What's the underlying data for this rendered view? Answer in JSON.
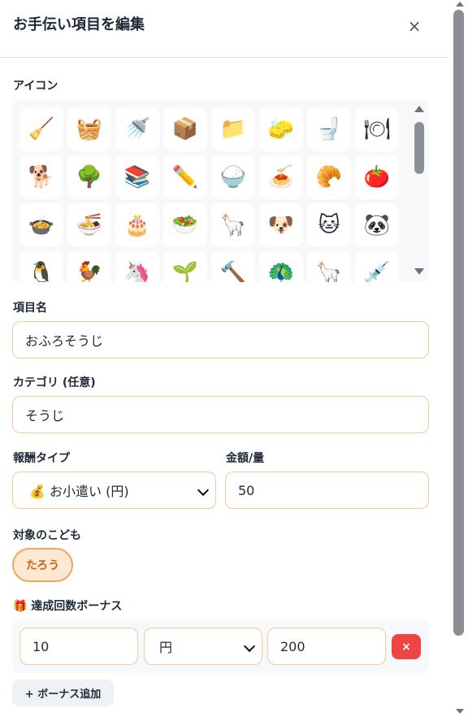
{
  "header": {
    "title": "お手伝い項目を編集",
    "close_label": "×"
  },
  "icon_section": {
    "label": "アイコン",
    "icons": [
      {
        "name": "broom-icon",
        "glyph": "🧹"
      },
      {
        "name": "basket-icon",
        "glyph": "🧺"
      },
      {
        "name": "shower-icon",
        "glyph": "🚿"
      },
      {
        "name": "package-icon",
        "glyph": "📦"
      },
      {
        "name": "folder-icon",
        "glyph": "📁"
      },
      {
        "name": "sponge-icon",
        "glyph": "🧽"
      },
      {
        "name": "toilet-icon",
        "glyph": "🚽"
      },
      {
        "name": "plate-cutlery-icon",
        "glyph": "🍽"
      },
      {
        "name": "dog-icon",
        "glyph": "🐕"
      },
      {
        "name": "tree-icon",
        "glyph": "🌳"
      },
      {
        "name": "books-icon",
        "glyph": "📚"
      },
      {
        "name": "pencil-icon",
        "glyph": "✏️"
      },
      {
        "name": "rice-bowl-icon",
        "glyph": "🍚"
      },
      {
        "name": "spaghetti-icon",
        "glyph": "🍝"
      },
      {
        "name": "croissant-icon",
        "glyph": "🥐"
      },
      {
        "name": "tomato-icon",
        "glyph": "🍅"
      },
      {
        "name": "stew-icon",
        "glyph": "🍲"
      },
      {
        "name": "ramen-icon",
        "glyph": "🍜"
      },
      {
        "name": "cake-icon",
        "glyph": "🎂"
      },
      {
        "name": "salad-icon",
        "glyph": "🥗"
      },
      {
        "name": "llama-icon",
        "glyph": "🦙"
      },
      {
        "name": "dog-face-icon",
        "glyph": "🐶"
      },
      {
        "name": "cat-face-icon",
        "glyph": "🐱"
      },
      {
        "name": "panda-icon",
        "glyph": "🐼"
      },
      {
        "name": "penguin-icon",
        "glyph": "🐧"
      },
      {
        "name": "rooster-icon",
        "glyph": "🐓"
      },
      {
        "name": "unicorn-icon",
        "glyph": "🦄"
      },
      {
        "name": "seedling-icon",
        "glyph": "🌱"
      },
      {
        "name": "hammer-icon",
        "glyph": "🔨"
      },
      {
        "name": "peacock-icon",
        "glyph": "🦚"
      },
      {
        "name": "alpaca-icon",
        "glyph": "🦙"
      },
      {
        "name": "syringe-icon",
        "glyph": "💉"
      }
    ]
  },
  "item_name": {
    "label": "項目名",
    "value": "おふろそうじ"
  },
  "category": {
    "label": "カテゴリ (任意)",
    "value": "そうじ"
  },
  "reward_type": {
    "label": "報酬タイプ",
    "value": "💰 お小遣い (円)"
  },
  "amount": {
    "label": "金額/量",
    "value": "50"
  },
  "target_children": {
    "label": "対象のこども",
    "children": [
      "たろう"
    ]
  },
  "bonus": {
    "label": "🎁 達成回数ボーナス",
    "rows": [
      {
        "count": "10",
        "unit": "円",
        "amount": "200",
        "remove_label": "×"
      }
    ],
    "add_label": "+ ボーナス追加"
  },
  "colors": {
    "accent": "#f0a560",
    "input_border": "#f6c89a",
    "danger": "#ef4444"
  }
}
